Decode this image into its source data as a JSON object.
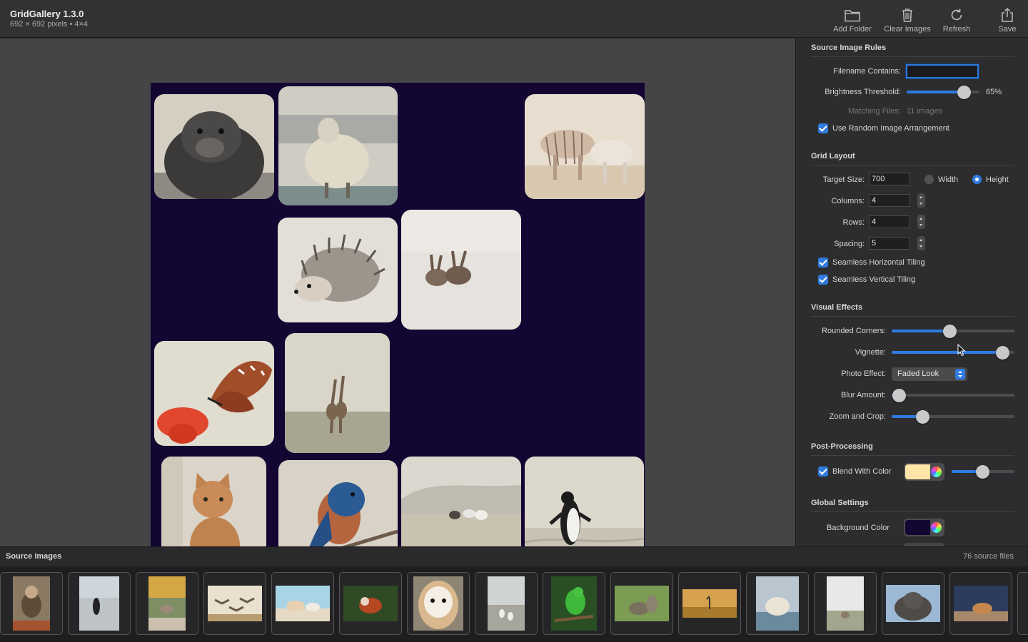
{
  "app": {
    "title": "GridGallery 1.3.0",
    "subtitle": "692 × 692 pixels • 4×4"
  },
  "toolbar": {
    "add_folder": "Add Folder",
    "clear_images": "Clear Images",
    "refresh": "Refresh",
    "save": "Save"
  },
  "canvas": {
    "background_color": "#130632",
    "tiles": [
      {
        "name": "sea-lion"
      },
      {
        "name": "sheep"
      },
      {
        "name": "zebras"
      },
      {
        "name": "hedgehog"
      },
      {
        "name": "hares"
      },
      {
        "name": "butterfly"
      },
      {
        "name": "giraffes"
      },
      {
        "name": "cat"
      },
      {
        "name": "bluebird"
      },
      {
        "name": "goats"
      },
      {
        "name": "penguin"
      }
    ]
  },
  "inspector": {
    "source_rules": {
      "title": "Source Image Rules",
      "filename_label": "Filename Contains:",
      "filename_value": "",
      "brightness_label": "Brightness Threshold:",
      "brightness_value": 65,
      "brightness_text": "65%",
      "matching_label": "Matching Files:",
      "matching_value": "11 images",
      "random_label": "Use Random Image Arrangement",
      "random_checked": true
    },
    "grid_layout": {
      "title": "Grid Layout",
      "target_label": "Target Size:",
      "target_value": "700",
      "width_label": "Width",
      "height_label": "Height",
      "dimension_selected": "Height",
      "columns_label": "Columns:",
      "columns_value": "4",
      "rows_label": "Rows:",
      "rows_value": "4",
      "spacing_label": "Spacing:",
      "spacing_value": "5",
      "seamless_h_label": "Seamless Horizontal Tiling",
      "seamless_h_checked": true,
      "seamless_v_label": "Seamless Vertical Tiling",
      "seamless_v_checked": true
    },
    "visual_effects": {
      "title": "Visual Effects",
      "rounded_label": "Rounded Corners:",
      "rounded_value": 0.47,
      "vignette_label": "Vignette:",
      "vignette_value": 0.9,
      "photo_effect_label": "Photo Effect:",
      "photo_effect_value": "Faded Look",
      "blur_label": "Blur Amount:",
      "blur_value": 0.06,
      "zoom_label": "Zoom and Crop:",
      "zoom_value": 0.25
    },
    "post_processing": {
      "title": "Post-Processing",
      "blend_label": "Blend With Color",
      "blend_checked": true,
      "blend_color": "#ffe4a8",
      "blend_amount": 0.49
    },
    "global_settings": {
      "title": "Global Settings",
      "background_label": "Background Color",
      "background_color": "#130632"
    }
  },
  "source_images": {
    "title": "Source Images",
    "count": "76 source files",
    "thumbs": [
      "monkey",
      "penguin-beach",
      "deer",
      "flying-geese",
      "horses",
      "red-panda",
      "owl",
      "ducks",
      "parrot",
      "squirrel",
      "crane-field",
      "sheep",
      "donkey",
      "sea-lion",
      "chipmunk"
    ]
  },
  "colors": {
    "accent": "#2f7be0"
  }
}
